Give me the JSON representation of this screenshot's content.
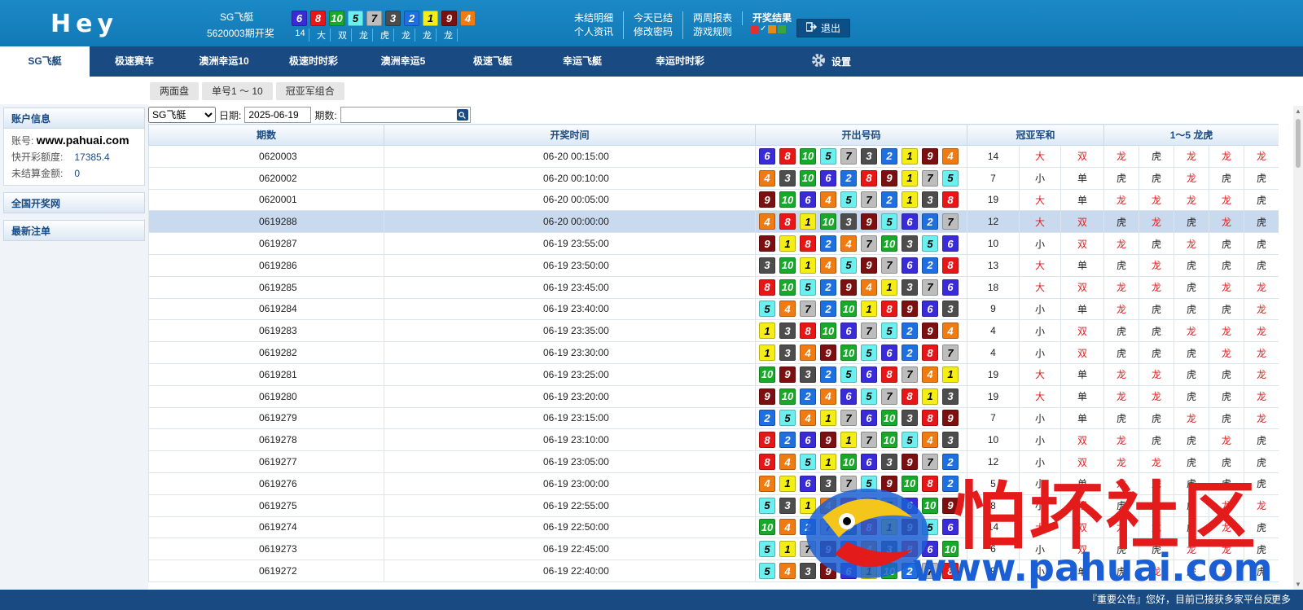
{
  "header": {
    "logo": "Hey",
    "current_game": "SG飞艇",
    "current_issue": "5620003期开奖",
    "current_balls": [
      "6",
      "8",
      "10",
      "5",
      "7",
      "3",
      "2",
      "1",
      "9",
      "4"
    ],
    "current_tags": [
      "14",
      "大",
      "双",
      "龙",
      "虎",
      "龙",
      "龙",
      "龙"
    ],
    "links_row1": [
      "未结明细",
      "今天已结",
      "两周报表",
      "开奖结果"
    ],
    "links_row2": [
      "个人资讯",
      "修改密码",
      "游戏规则"
    ],
    "skin_check": "✓",
    "logout_label": "退出"
  },
  "nav": {
    "items": [
      "SG飞艇",
      "极速赛车",
      "澳洲幸运10",
      "极速时时彩",
      "澳洲幸运5",
      "极速飞艇",
      "幸运飞艇",
      "幸运时时彩"
    ],
    "active": 0,
    "settings_label": "设置"
  },
  "subtabs": [
    "两面盘",
    "单号1 ～ 10",
    "冠亚军组合"
  ],
  "sidebar": {
    "account_title": "账户信息",
    "account_label": "账号:",
    "account_value": "www.pahuai.com",
    "quota_label": "快开彩额度:",
    "quota_value": "17385.4",
    "unsettled_label": "未结算金额:",
    "unsettled_value": "0",
    "national_title": "全国开奖网",
    "latest_title": "最新注单"
  },
  "filter": {
    "game_option": "SG飞艇",
    "date_label": "日期:",
    "date_value": "2025-06-19",
    "issue_label": "期数:",
    "issue_value": ""
  },
  "table": {
    "headers": [
      "期数",
      "开奖时间",
      "开出号码",
      "冠亚军和",
      "1～5 龙虎"
    ],
    "rows": [
      {
        "issue": "0620003",
        "time": "06-20 00:15:00",
        "balls": [
          "6",
          "8",
          "10",
          "5",
          "7",
          "3",
          "2",
          "1",
          "9",
          "4"
        ],
        "sum": "14",
        "bs": "大",
        "oe": "双",
        "dt": [
          "龙",
          "虎",
          "龙",
          "龙",
          "龙"
        ]
      },
      {
        "issue": "0620002",
        "time": "06-20 00:10:00",
        "balls": [
          "4",
          "3",
          "10",
          "6",
          "2",
          "8",
          "9",
          "1",
          "7",
          "5"
        ],
        "sum": "7",
        "bs": "小",
        "oe": "单",
        "dt": [
          "虎",
          "虎",
          "龙",
          "虎",
          "虎"
        ]
      },
      {
        "issue": "0620001",
        "time": "06-20 00:05:00",
        "balls": [
          "9",
          "10",
          "6",
          "4",
          "5",
          "7",
          "2",
          "1",
          "3",
          "8"
        ],
        "sum": "19",
        "bs": "大",
        "oe": "单",
        "dt": [
          "龙",
          "龙",
          "龙",
          "龙",
          "虎"
        ]
      },
      {
        "issue": "0619288",
        "time": "06-20 00:00:00",
        "balls": [
          "4",
          "8",
          "1",
          "10",
          "3",
          "9",
          "5",
          "6",
          "2",
          "7"
        ],
        "sum": "12",
        "bs": "大",
        "oe": "双",
        "dt": [
          "虎",
          "龙",
          "虎",
          "龙",
          "虎"
        ]
      },
      {
        "issue": "0619287",
        "time": "06-19 23:55:00",
        "balls": [
          "9",
          "1",
          "8",
          "2",
          "4",
          "7",
          "10",
          "3",
          "5",
          "6"
        ],
        "sum": "10",
        "bs": "小",
        "oe": "双",
        "dt": [
          "龙",
          "虎",
          "龙",
          "虎",
          "虎"
        ]
      },
      {
        "issue": "0619286",
        "time": "06-19 23:50:00",
        "balls": [
          "3",
          "10",
          "1",
          "4",
          "5",
          "9",
          "7",
          "6",
          "2",
          "8"
        ],
        "sum": "13",
        "bs": "大",
        "oe": "单",
        "dt": [
          "虎",
          "龙",
          "虎",
          "虎",
          "虎"
        ]
      },
      {
        "issue": "0619285",
        "time": "06-19 23:45:00",
        "balls": [
          "8",
          "10",
          "5",
          "2",
          "9",
          "4",
          "1",
          "3",
          "7",
          "6"
        ],
        "sum": "18",
        "bs": "大",
        "oe": "双",
        "dt": [
          "龙",
          "龙",
          "虎",
          "龙",
          "龙"
        ]
      },
      {
        "issue": "0619284",
        "time": "06-19 23:40:00",
        "balls": [
          "5",
          "4",
          "7",
          "2",
          "10",
          "1",
          "8",
          "9",
          "6",
          "3"
        ],
        "sum": "9",
        "bs": "小",
        "oe": "单",
        "dt": [
          "龙",
          "虎",
          "虎",
          "虎",
          "龙"
        ]
      },
      {
        "issue": "0619283",
        "time": "06-19 23:35:00",
        "balls": [
          "1",
          "3",
          "8",
          "10",
          "6",
          "7",
          "5",
          "2",
          "9",
          "4"
        ],
        "sum": "4",
        "bs": "小",
        "oe": "双",
        "dt": [
          "虎",
          "虎",
          "龙",
          "龙",
          "龙"
        ]
      },
      {
        "issue": "0619282",
        "time": "06-19 23:30:00",
        "balls": [
          "1",
          "3",
          "4",
          "9",
          "10",
          "5",
          "6",
          "2",
          "8",
          "7"
        ],
        "sum": "4",
        "bs": "小",
        "oe": "双",
        "dt": [
          "虎",
          "虎",
          "虎",
          "龙",
          "龙"
        ]
      },
      {
        "issue": "0619281",
        "time": "06-19 23:25:00",
        "balls": [
          "10",
          "9",
          "3",
          "2",
          "5",
          "6",
          "8",
          "7",
          "4",
          "1"
        ],
        "sum": "19",
        "bs": "大",
        "oe": "单",
        "dt": [
          "龙",
          "龙",
          "虎",
          "虎",
          "龙"
        ]
      },
      {
        "issue": "0619280",
        "time": "06-19 23:20:00",
        "balls": [
          "9",
          "10",
          "2",
          "4",
          "6",
          "5",
          "7",
          "8",
          "1",
          "3"
        ],
        "sum": "19",
        "bs": "大",
        "oe": "单",
        "dt": [
          "龙",
          "龙",
          "虎",
          "虎",
          "龙"
        ]
      },
      {
        "issue": "0619279",
        "time": "06-19 23:15:00",
        "balls": [
          "2",
          "5",
          "4",
          "1",
          "7",
          "6",
          "10",
          "3",
          "8",
          "9"
        ],
        "sum": "7",
        "bs": "小",
        "oe": "单",
        "dt": [
          "虎",
          "虎",
          "龙",
          "虎",
          "龙"
        ]
      },
      {
        "issue": "0619278",
        "time": "06-19 23:10:00",
        "balls": [
          "8",
          "2",
          "6",
          "9",
          "1",
          "7",
          "10",
          "5",
          "4",
          "3"
        ],
        "sum": "10",
        "bs": "小",
        "oe": "双",
        "dt": [
          "龙",
          "虎",
          "虎",
          "龙",
          "虎"
        ]
      },
      {
        "issue": "0619277",
        "time": "06-19 23:05:00",
        "balls": [
          "8",
          "4",
          "5",
          "1",
          "10",
          "6",
          "3",
          "9",
          "7",
          "2"
        ],
        "sum": "12",
        "bs": "小",
        "oe": "双",
        "dt": [
          "龙",
          "龙",
          "虎",
          "虎",
          "虎"
        ]
      },
      {
        "issue": "0619276",
        "time": "06-19 23:00:00",
        "balls": [
          "4",
          "1",
          "6",
          "3",
          "7",
          "5",
          "9",
          "10",
          "8",
          "2"
        ],
        "sum": "5",
        "bs": "小",
        "oe": "单",
        "dt": [
          "龙",
          "虎",
          "虎",
          "虎",
          "虎"
        ]
      },
      {
        "issue": "0619275",
        "time": "06-19 22:55:00",
        "balls": [
          "5",
          "3",
          "1",
          "4",
          "8",
          "2",
          "7",
          "6",
          "10",
          "9"
        ],
        "sum": "8",
        "bs": "小",
        "oe": "双",
        "dt": [
          "虎",
          "虎",
          "虎",
          "龙",
          "龙"
        ]
      },
      {
        "issue": "0619274",
        "time": "06-19 22:50:00",
        "balls": [
          "10",
          "4",
          "2",
          "7",
          "3",
          "8",
          "1",
          "9",
          "5",
          "6"
        ],
        "sum": "14",
        "bs": "大",
        "oe": "双",
        "dt": [
          "龙",
          "龙",
          "虎",
          "龙",
          "虎"
        ]
      },
      {
        "issue": "0619273",
        "time": "06-19 22:45:00",
        "balls": [
          "5",
          "1",
          "7",
          "9",
          "2",
          "4",
          "3",
          "8",
          "6",
          "10"
        ],
        "sum": "6",
        "bs": "小",
        "oe": "双",
        "dt": [
          "虎",
          "虎",
          "龙",
          "龙",
          "虎"
        ]
      },
      {
        "issue": "0619272",
        "time": "06-19 22:40:00",
        "balls": [
          "5",
          "4",
          "3",
          "9",
          "6",
          "1",
          "10",
          "2",
          "7",
          "8"
        ],
        "sum": "9",
        "bs": "小",
        "oe": "单",
        "dt": [
          "虎",
          "龙",
          "虎",
          "龙",
          "虎"
        ]
      }
    ],
    "selected_row": 3
  },
  "ball_colors": {
    "1": "#f5ee16",
    "2": "#1e6fe0",
    "3": "#4d4d4d",
    "4": "#f07b12",
    "5": "#6cf0ef",
    "6": "#3a2bd8",
    "7": "#bdbdbd",
    "8": "#e81616",
    "9": "#7c0f0f",
    "10": "#18a82a"
  },
  "footer": {
    "notice": "『重要公告』您好，目前已接获多家平台反",
    "more": "更多"
  },
  "watermark": {
    "cn": "怕坏社区",
    "url": "www.pahuai.com"
  }
}
